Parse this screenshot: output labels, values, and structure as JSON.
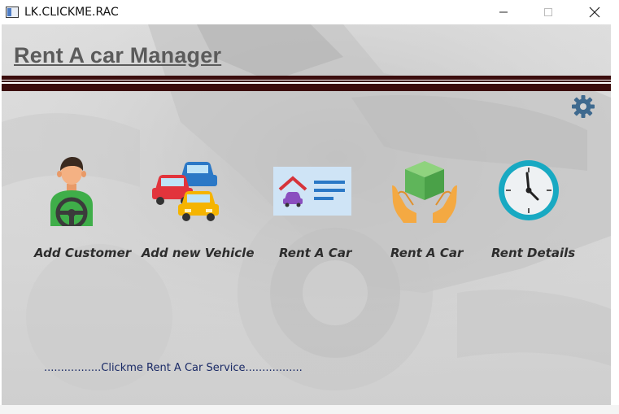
{
  "window": {
    "title": "LK.CLICKME.RAC",
    "controls": [
      "minimize",
      "maximize",
      "close"
    ]
  },
  "header": {
    "title": "Rent A car Manager",
    "rule_color": "#3b0d0d"
  },
  "toolbar": {
    "settings_icon": "gear-icon"
  },
  "tiles": [
    {
      "label": "Add Customer",
      "icon": "driver-icon"
    },
    {
      "label": "Add new Vehicle",
      "icon": "cars-icon"
    },
    {
      "label": "Rent A Car",
      "icon": "house-car-card-icon"
    },
    {
      "label": "Rent A Car",
      "icon": "box-hands-icon"
    },
    {
      "label": "Rent Details",
      "icon": "clock-icon"
    }
  ],
  "footer": {
    "text": ".................Clickme Rent A Car Service................."
  }
}
